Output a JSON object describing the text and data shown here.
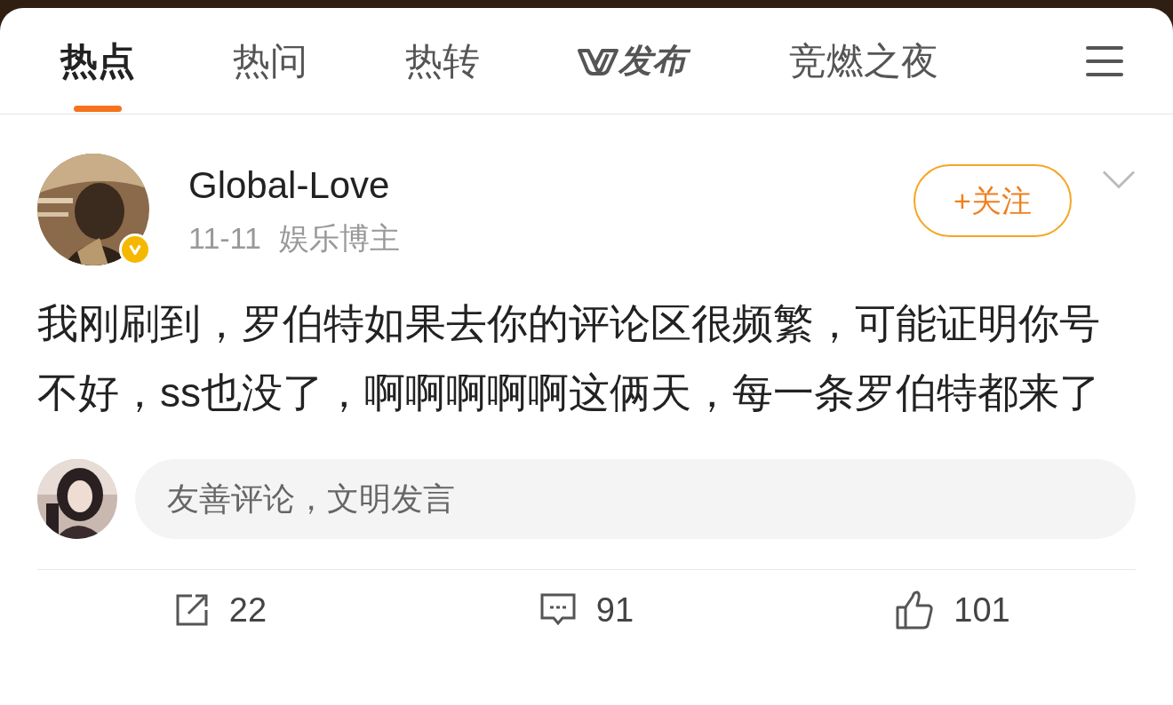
{
  "tabs": [
    {
      "label": "热点",
      "selected": true,
      "kind": "text"
    },
    {
      "label": "热问",
      "selected": false,
      "kind": "text"
    },
    {
      "label": "热转",
      "selected": false,
      "kind": "text"
    },
    {
      "label": "发布",
      "selected": false,
      "kind": "logo"
    },
    {
      "label": "竞燃之夜",
      "selected": false,
      "kind": "text"
    }
  ],
  "post": {
    "author": "Global-Love",
    "verified": true,
    "date": "11-11",
    "category": "娱乐博主",
    "follow_button": "+关注",
    "text": "我刚刷到，罗伯特如果去你的评论区很频繁，可能证明你号不好，ss也没了，啊啊啊啊啊这俩天，每一条罗伯特都来了"
  },
  "comment_box": {
    "placeholder": "友善评论，文明发言"
  },
  "actions": [
    {
      "kind": "share",
      "count": "22"
    },
    {
      "kind": "comment",
      "count": "91"
    },
    {
      "kind": "like",
      "count": "101"
    }
  ]
}
